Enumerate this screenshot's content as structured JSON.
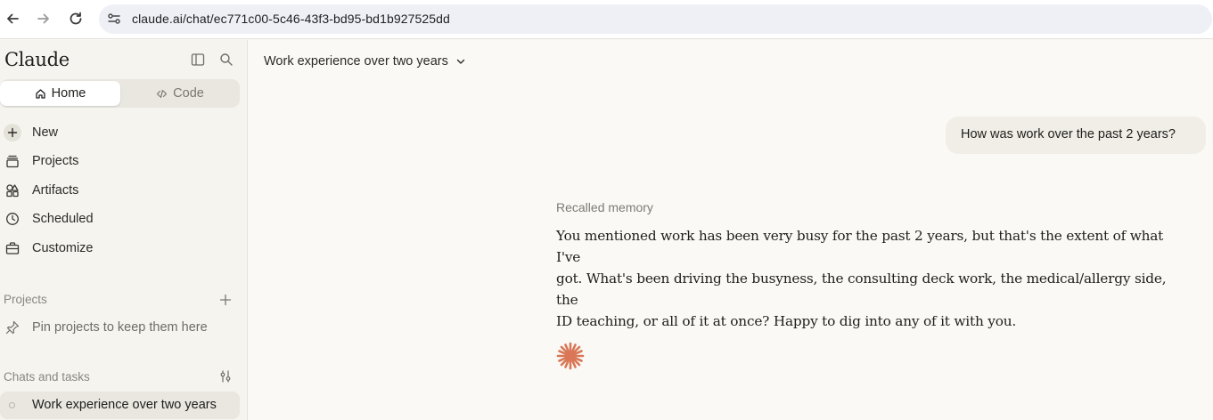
{
  "browser": {
    "url": "claude.ai/chat/ec771c00-5c46-43f3-bd95-bd1b927525dd",
    "icons": [
      "back-arrow-icon",
      "forward-arrow-icon",
      "reload-icon",
      "site-info-icon"
    ]
  },
  "sidebar": {
    "brand": "Claude",
    "segments": {
      "home": "Home",
      "code": "Code"
    },
    "nav": [
      {
        "label": "New",
        "icon": "plus-icon"
      },
      {
        "label": "Projects",
        "icon": "projects-icon"
      },
      {
        "label": "Artifacts",
        "icon": "artifacts-icon"
      },
      {
        "label": "Scheduled",
        "icon": "clock-icon"
      },
      {
        "label": "Customize",
        "icon": "briefcase-icon"
      }
    ],
    "projects_title": "Projects",
    "pin_hint": "Pin projects to keep them here",
    "chats_title": "Chats and tasks",
    "active_chat": "Work experience over two years"
  },
  "main": {
    "chat_title": "Work experience over two years",
    "user_message": "How was work over the past 2 years?",
    "recalled_label": "Recalled memory",
    "reply_lines": [
      "You mentioned work has been very busy for the past 2 years, but that's the extent of what I've",
      "got. What's been driving the busyness, the consulting deck work, the medical/allergy side, the",
      "ID teaching, or all of it at once? Happy to dig into any of it with you."
    ]
  },
  "colors": {
    "accent": "#d97757",
    "sidebar_bg": "#f5f4ef",
    "page_bg": "#faf9f5"
  }
}
